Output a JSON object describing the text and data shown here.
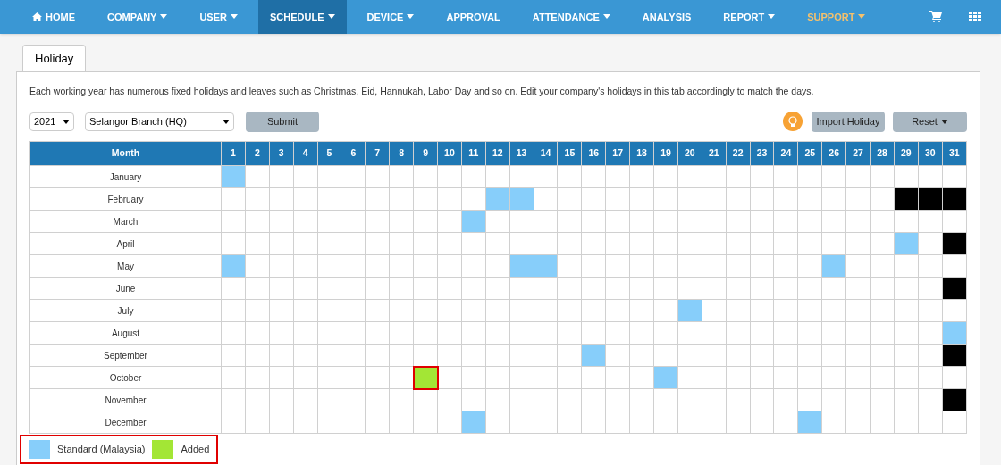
{
  "nav": [
    {
      "label": "HOME",
      "kind": "home",
      "selected": false,
      "dropdown": false,
      "highlight": false
    },
    {
      "label": "COMPANY",
      "kind": "plain",
      "selected": false,
      "dropdown": true,
      "highlight": false
    },
    {
      "label": "USER",
      "kind": "plain",
      "selected": false,
      "dropdown": true,
      "highlight": false
    },
    {
      "label": "SCHEDULE",
      "kind": "plain",
      "selected": true,
      "dropdown": true,
      "highlight": false
    },
    {
      "label": "DEVICE",
      "kind": "plain",
      "selected": false,
      "dropdown": true,
      "highlight": false
    },
    {
      "label": "APPROVAL",
      "kind": "plain",
      "selected": false,
      "dropdown": false,
      "highlight": false
    },
    {
      "label": "ATTENDANCE",
      "kind": "plain",
      "selected": false,
      "dropdown": true,
      "highlight": false
    },
    {
      "label": "ANALYSIS",
      "kind": "plain",
      "selected": false,
      "dropdown": false,
      "highlight": false
    },
    {
      "label": "REPORT",
      "kind": "plain",
      "selected": false,
      "dropdown": true,
      "highlight": false
    },
    {
      "label": "SUPPORT",
      "kind": "plain",
      "selected": false,
      "dropdown": true,
      "highlight": true
    }
  ],
  "tab": {
    "label": "Holiday",
    "selected": true
  },
  "description": "Each working year has numerous fixed holidays and leaves such as Christmas, Eid, Hannukah, Labor Day and so on. Edit your company's holidays in this tab accordingly to match the days.",
  "year": "2021",
  "branch": "Selangor Branch (HQ)",
  "submit": "Submit",
  "import": "Import Holiday",
  "reset": "Reset",
  "table": {
    "month_header": "Month",
    "days": [
      "1",
      "2",
      "3",
      "4",
      "5",
      "6",
      "7",
      "8",
      "9",
      "10",
      "11",
      "12",
      "13",
      "14",
      "15",
      "16",
      "17",
      "18",
      "19",
      "20",
      "21",
      "22",
      "23",
      "24",
      "25",
      "26",
      "27",
      "28",
      "29",
      "30",
      "31"
    ],
    "rows": [
      {
        "month": "January",
        "cells": [
          {
            "kind": "standard"
          },
          {
            "kind": "none"
          },
          {
            "kind": "none"
          },
          {
            "kind": "none"
          },
          {
            "kind": "none"
          },
          {
            "kind": "none"
          },
          {
            "kind": "none"
          },
          {
            "kind": "none"
          },
          {
            "kind": "none"
          },
          {
            "kind": "none"
          },
          {
            "kind": "none"
          },
          {
            "kind": "none"
          },
          {
            "kind": "none"
          },
          {
            "kind": "none"
          },
          {
            "kind": "none"
          },
          {
            "kind": "none"
          },
          {
            "kind": "none"
          },
          {
            "kind": "none"
          },
          {
            "kind": "none"
          },
          {
            "kind": "none"
          },
          {
            "kind": "none"
          },
          {
            "kind": "none"
          },
          {
            "kind": "none"
          },
          {
            "kind": "none"
          },
          {
            "kind": "none"
          },
          {
            "kind": "none"
          },
          {
            "kind": "none"
          },
          {
            "kind": "none"
          },
          {
            "kind": "none"
          },
          {
            "kind": "none"
          },
          {
            "kind": "none"
          }
        ]
      },
      {
        "month": "February",
        "cells": [
          {
            "kind": "none"
          },
          {
            "kind": "none"
          },
          {
            "kind": "none"
          },
          {
            "kind": "none"
          },
          {
            "kind": "none"
          },
          {
            "kind": "none"
          },
          {
            "kind": "none"
          },
          {
            "kind": "none"
          },
          {
            "kind": "none"
          },
          {
            "kind": "none"
          },
          {
            "kind": "none"
          },
          {
            "kind": "standard"
          },
          {
            "kind": "standard"
          },
          {
            "kind": "none"
          },
          {
            "kind": "none"
          },
          {
            "kind": "none"
          },
          {
            "kind": "none"
          },
          {
            "kind": "none"
          },
          {
            "kind": "none"
          },
          {
            "kind": "none"
          },
          {
            "kind": "none"
          },
          {
            "kind": "none"
          },
          {
            "kind": "none"
          },
          {
            "kind": "none"
          },
          {
            "kind": "none"
          },
          {
            "kind": "none"
          },
          {
            "kind": "none"
          },
          {
            "kind": "none"
          },
          {
            "kind": "invalid"
          },
          {
            "kind": "invalid"
          },
          {
            "kind": "invalid"
          }
        ]
      },
      {
        "month": "March",
        "cells": [
          {
            "kind": "none"
          },
          {
            "kind": "none"
          },
          {
            "kind": "none"
          },
          {
            "kind": "none"
          },
          {
            "kind": "none"
          },
          {
            "kind": "none"
          },
          {
            "kind": "none"
          },
          {
            "kind": "none"
          },
          {
            "kind": "none"
          },
          {
            "kind": "none"
          },
          {
            "kind": "standard"
          },
          {
            "kind": "none"
          },
          {
            "kind": "none"
          },
          {
            "kind": "none"
          },
          {
            "kind": "none"
          },
          {
            "kind": "none"
          },
          {
            "kind": "none"
          },
          {
            "kind": "none"
          },
          {
            "kind": "none"
          },
          {
            "kind": "none"
          },
          {
            "kind": "none"
          },
          {
            "kind": "none"
          },
          {
            "kind": "none"
          },
          {
            "kind": "none"
          },
          {
            "kind": "none"
          },
          {
            "kind": "none"
          },
          {
            "kind": "none"
          },
          {
            "kind": "none"
          },
          {
            "kind": "none"
          },
          {
            "kind": "none"
          },
          {
            "kind": "none"
          }
        ]
      },
      {
        "month": "April",
        "cells": [
          {
            "kind": "none"
          },
          {
            "kind": "none"
          },
          {
            "kind": "none"
          },
          {
            "kind": "none"
          },
          {
            "kind": "none"
          },
          {
            "kind": "none"
          },
          {
            "kind": "none"
          },
          {
            "kind": "none"
          },
          {
            "kind": "none"
          },
          {
            "kind": "none"
          },
          {
            "kind": "none"
          },
          {
            "kind": "none"
          },
          {
            "kind": "none"
          },
          {
            "kind": "none"
          },
          {
            "kind": "none"
          },
          {
            "kind": "none"
          },
          {
            "kind": "none"
          },
          {
            "kind": "none"
          },
          {
            "kind": "none"
          },
          {
            "kind": "none"
          },
          {
            "kind": "none"
          },
          {
            "kind": "none"
          },
          {
            "kind": "none"
          },
          {
            "kind": "none"
          },
          {
            "kind": "none"
          },
          {
            "kind": "none"
          },
          {
            "kind": "none"
          },
          {
            "kind": "none"
          },
          {
            "kind": "standard"
          },
          {
            "kind": "none"
          },
          {
            "kind": "invalid"
          }
        ]
      },
      {
        "month": "May",
        "cells": [
          {
            "kind": "standard"
          },
          {
            "kind": "none"
          },
          {
            "kind": "none"
          },
          {
            "kind": "none"
          },
          {
            "kind": "none"
          },
          {
            "kind": "none"
          },
          {
            "kind": "none"
          },
          {
            "kind": "none"
          },
          {
            "kind": "none"
          },
          {
            "kind": "none"
          },
          {
            "kind": "none"
          },
          {
            "kind": "none"
          },
          {
            "kind": "standard"
          },
          {
            "kind": "standard"
          },
          {
            "kind": "none"
          },
          {
            "kind": "none"
          },
          {
            "kind": "none"
          },
          {
            "kind": "none"
          },
          {
            "kind": "none"
          },
          {
            "kind": "none"
          },
          {
            "kind": "none"
          },
          {
            "kind": "none"
          },
          {
            "kind": "none"
          },
          {
            "kind": "none"
          },
          {
            "kind": "none"
          },
          {
            "kind": "standard"
          },
          {
            "kind": "none"
          },
          {
            "kind": "none"
          },
          {
            "kind": "none"
          },
          {
            "kind": "none"
          },
          {
            "kind": "none"
          }
        ]
      },
      {
        "month": "June",
        "cells": [
          {
            "kind": "none"
          },
          {
            "kind": "none"
          },
          {
            "kind": "none"
          },
          {
            "kind": "none"
          },
          {
            "kind": "none"
          },
          {
            "kind": "none"
          },
          {
            "kind": "none"
          },
          {
            "kind": "none"
          },
          {
            "kind": "none"
          },
          {
            "kind": "none"
          },
          {
            "kind": "none"
          },
          {
            "kind": "none"
          },
          {
            "kind": "none"
          },
          {
            "kind": "none"
          },
          {
            "kind": "none"
          },
          {
            "kind": "none"
          },
          {
            "kind": "none"
          },
          {
            "kind": "none"
          },
          {
            "kind": "none"
          },
          {
            "kind": "none"
          },
          {
            "kind": "none"
          },
          {
            "kind": "none"
          },
          {
            "kind": "none"
          },
          {
            "kind": "none"
          },
          {
            "kind": "none"
          },
          {
            "kind": "none"
          },
          {
            "kind": "none"
          },
          {
            "kind": "none"
          },
          {
            "kind": "none"
          },
          {
            "kind": "none"
          },
          {
            "kind": "invalid"
          }
        ]
      },
      {
        "month": "July",
        "cells": [
          {
            "kind": "none"
          },
          {
            "kind": "none"
          },
          {
            "kind": "none"
          },
          {
            "kind": "none"
          },
          {
            "kind": "none"
          },
          {
            "kind": "none"
          },
          {
            "kind": "none"
          },
          {
            "kind": "none"
          },
          {
            "kind": "none"
          },
          {
            "kind": "none"
          },
          {
            "kind": "none"
          },
          {
            "kind": "none"
          },
          {
            "kind": "none"
          },
          {
            "kind": "none"
          },
          {
            "kind": "none"
          },
          {
            "kind": "none"
          },
          {
            "kind": "none"
          },
          {
            "kind": "none"
          },
          {
            "kind": "none"
          },
          {
            "kind": "standard"
          },
          {
            "kind": "none"
          },
          {
            "kind": "none"
          },
          {
            "kind": "none"
          },
          {
            "kind": "none"
          },
          {
            "kind": "none"
          },
          {
            "kind": "none"
          },
          {
            "kind": "none"
          },
          {
            "kind": "none"
          },
          {
            "kind": "none"
          },
          {
            "kind": "none"
          },
          {
            "kind": "none"
          }
        ]
      },
      {
        "month": "August",
        "cells": [
          {
            "kind": "none"
          },
          {
            "kind": "none"
          },
          {
            "kind": "none"
          },
          {
            "kind": "none"
          },
          {
            "kind": "none"
          },
          {
            "kind": "none"
          },
          {
            "kind": "none"
          },
          {
            "kind": "none"
          },
          {
            "kind": "none"
          },
          {
            "kind": "none"
          },
          {
            "kind": "none"
          },
          {
            "kind": "none"
          },
          {
            "kind": "none"
          },
          {
            "kind": "none"
          },
          {
            "kind": "none"
          },
          {
            "kind": "none"
          },
          {
            "kind": "none"
          },
          {
            "kind": "none"
          },
          {
            "kind": "none"
          },
          {
            "kind": "none"
          },
          {
            "kind": "none"
          },
          {
            "kind": "none"
          },
          {
            "kind": "none"
          },
          {
            "kind": "none"
          },
          {
            "kind": "none"
          },
          {
            "kind": "none"
          },
          {
            "kind": "none"
          },
          {
            "kind": "none"
          },
          {
            "kind": "none"
          },
          {
            "kind": "none"
          },
          {
            "kind": "standard"
          }
        ]
      },
      {
        "month": "September",
        "cells": [
          {
            "kind": "none"
          },
          {
            "kind": "none"
          },
          {
            "kind": "none"
          },
          {
            "kind": "none"
          },
          {
            "kind": "none"
          },
          {
            "kind": "none"
          },
          {
            "kind": "none"
          },
          {
            "kind": "none"
          },
          {
            "kind": "none"
          },
          {
            "kind": "none"
          },
          {
            "kind": "none"
          },
          {
            "kind": "none"
          },
          {
            "kind": "none"
          },
          {
            "kind": "none"
          },
          {
            "kind": "none"
          },
          {
            "kind": "standard"
          },
          {
            "kind": "none"
          },
          {
            "kind": "none"
          },
          {
            "kind": "none"
          },
          {
            "kind": "none"
          },
          {
            "kind": "none"
          },
          {
            "kind": "none"
          },
          {
            "kind": "none"
          },
          {
            "kind": "none"
          },
          {
            "kind": "none"
          },
          {
            "kind": "none"
          },
          {
            "kind": "none"
          },
          {
            "kind": "none"
          },
          {
            "kind": "none"
          },
          {
            "kind": "none"
          },
          {
            "kind": "invalid"
          }
        ]
      },
      {
        "month": "October",
        "cells": [
          {
            "kind": "none"
          },
          {
            "kind": "none"
          },
          {
            "kind": "none"
          },
          {
            "kind": "none"
          },
          {
            "kind": "none"
          },
          {
            "kind": "none"
          },
          {
            "kind": "none"
          },
          {
            "kind": "none"
          },
          {
            "kind": "added"
          },
          {
            "kind": "none"
          },
          {
            "kind": "none"
          },
          {
            "kind": "none"
          },
          {
            "kind": "none"
          },
          {
            "kind": "none"
          },
          {
            "kind": "none"
          },
          {
            "kind": "none"
          },
          {
            "kind": "none"
          },
          {
            "kind": "none"
          },
          {
            "kind": "standard"
          },
          {
            "kind": "none"
          },
          {
            "kind": "none"
          },
          {
            "kind": "none"
          },
          {
            "kind": "none"
          },
          {
            "kind": "none"
          },
          {
            "kind": "none"
          },
          {
            "kind": "none"
          },
          {
            "kind": "none"
          },
          {
            "kind": "none"
          },
          {
            "kind": "none"
          },
          {
            "kind": "none"
          },
          {
            "kind": "none"
          }
        ]
      },
      {
        "month": "November",
        "cells": [
          {
            "kind": "none"
          },
          {
            "kind": "none"
          },
          {
            "kind": "none"
          },
          {
            "kind": "none"
          },
          {
            "kind": "none"
          },
          {
            "kind": "none"
          },
          {
            "kind": "none"
          },
          {
            "kind": "none"
          },
          {
            "kind": "none"
          },
          {
            "kind": "none"
          },
          {
            "kind": "none"
          },
          {
            "kind": "none"
          },
          {
            "kind": "none"
          },
          {
            "kind": "none"
          },
          {
            "kind": "none"
          },
          {
            "kind": "none"
          },
          {
            "kind": "none"
          },
          {
            "kind": "none"
          },
          {
            "kind": "none"
          },
          {
            "kind": "none"
          },
          {
            "kind": "none"
          },
          {
            "kind": "none"
          },
          {
            "kind": "none"
          },
          {
            "kind": "none"
          },
          {
            "kind": "none"
          },
          {
            "kind": "none"
          },
          {
            "kind": "none"
          },
          {
            "kind": "none"
          },
          {
            "kind": "none"
          },
          {
            "kind": "none"
          },
          {
            "kind": "invalid"
          }
        ]
      },
      {
        "month": "December",
        "cells": [
          {
            "kind": "none"
          },
          {
            "kind": "none"
          },
          {
            "kind": "none"
          },
          {
            "kind": "none"
          },
          {
            "kind": "none"
          },
          {
            "kind": "none"
          },
          {
            "kind": "none"
          },
          {
            "kind": "none"
          },
          {
            "kind": "none"
          },
          {
            "kind": "none"
          },
          {
            "kind": "standard"
          },
          {
            "kind": "none"
          },
          {
            "kind": "none"
          },
          {
            "kind": "none"
          },
          {
            "kind": "none"
          },
          {
            "kind": "none"
          },
          {
            "kind": "none"
          },
          {
            "kind": "none"
          },
          {
            "kind": "none"
          },
          {
            "kind": "none"
          },
          {
            "kind": "none"
          },
          {
            "kind": "none"
          },
          {
            "kind": "none"
          },
          {
            "kind": "none"
          },
          {
            "kind": "standard"
          },
          {
            "kind": "none"
          },
          {
            "kind": "none"
          },
          {
            "kind": "none"
          },
          {
            "kind": "none"
          },
          {
            "kind": "none"
          },
          {
            "kind": "none"
          }
        ]
      }
    ]
  },
  "legend": [
    {
      "label": "Standard (Malaysia)",
      "color": "#87cefa"
    },
    {
      "label": "Added",
      "color": "#a3e635"
    }
  ]
}
